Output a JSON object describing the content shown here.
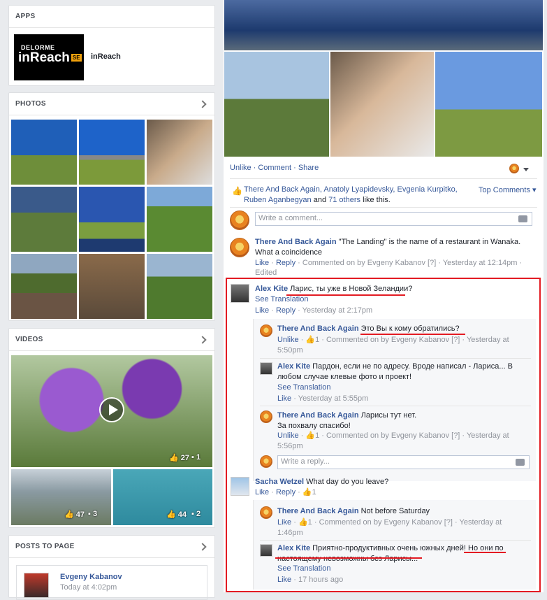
{
  "apps": {
    "header": "APPS",
    "item_name": "inReach",
    "logo_brand": "DELORME",
    "logo_product": "inReach",
    "logo_badge": "SE"
  },
  "photos": {
    "header": "PHOTOS"
  },
  "videos": {
    "header": "VIDEOS",
    "main_likes": "27",
    "main_comments": "1",
    "v2_likes": "47",
    "v2_comments": "3",
    "v3_likes": "44",
    "v3_comments": "2"
  },
  "posts": {
    "header": "POSTS TO PAGE",
    "author": "Evgeny Kabanov",
    "time": "Today at 4:02pm"
  },
  "actions": {
    "unlike": "Unlike",
    "comment": "Comment",
    "share": "Share",
    "top_comments": "Top Comments"
  },
  "likes_line": {
    "names": "There And Back Again, Anatoly Lyapidevsky, Evgenia Kurpitko, Ruben Aganbegyan",
    "and": "and",
    "others": "71 others",
    "suffix": "like this."
  },
  "comment_input": {
    "placeholder": "Write a comment..."
  },
  "reply_input": {
    "placeholder": "Write a reply..."
  },
  "comments": [
    {
      "author": "There And Back Again",
      "text": "\"The Landing\" is the name of a restaurant in Wanaka. What a coincidence",
      "like": "Like",
      "reply": "Reply",
      "meta": "· Commented on by Evgeny Kabanov [?] · Yesterday at 12:14pm ·",
      "edited": "Edited"
    },
    {
      "author": "Alex Kite",
      "text": "Ларис, ты уже в Новой Зеландии?",
      "see_translation": "See Translation",
      "like": "Like",
      "reply": "Reply",
      "meta": "· Yesterday at 2:17pm"
    },
    {
      "author": "There And Back Again",
      "text": "Это Вы к кому обратились?",
      "unlike": "Unlike",
      "likes": "1",
      "meta": "· Commented on by Evgeny Kabanov [?] · Yesterday at",
      "time2": "5:50pm"
    },
    {
      "author": "Alex Kite",
      "text": "Пардон, если не по адресу. Вроде написал - Лариса... В любом случае клевые фото и проект!",
      "see_translation": "See Translation",
      "like": "Like",
      "meta": "· Yesterday at 5:55pm"
    },
    {
      "author": "There And Back Again",
      "text": "Ларисы тут нет.",
      "text2": "За похвалу спасибо!",
      "unlike": "Unlike",
      "likes": "1",
      "meta": "· Commented on by Evgeny Kabanov [?] · Yesterday at",
      "time2": "5:56pm"
    },
    {
      "author": "Sacha Wetzel",
      "text": "What day do you leave?",
      "like": "Like",
      "reply": "Reply",
      "likes": "1"
    },
    {
      "author": "There And Back Again",
      "text": "Not before Saturday",
      "like": "Like",
      "likes": "1",
      "meta": "· Commented on by Evgeny Kabanov [?] · Yesterday at",
      "time2": "1:46pm"
    },
    {
      "author": "Alex Kite",
      "text": "Приятно-продуктивных очень южных дней! Но они по настоящему невозможны без Ларисы...",
      "see_translation": "See Translation",
      "like": "Like",
      "meta": "· 17 hours ago"
    }
  ]
}
